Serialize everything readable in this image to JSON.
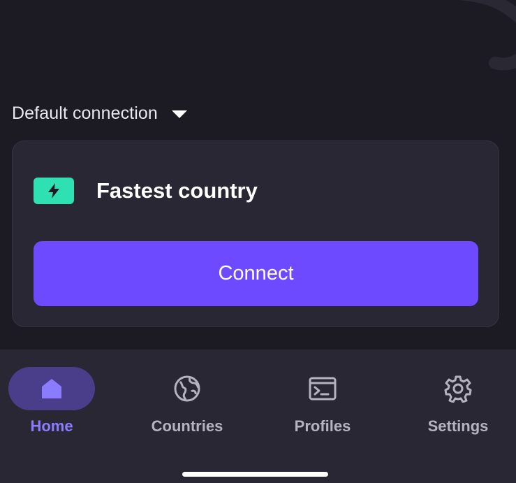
{
  "connection": {
    "selector_label": "Default connection"
  },
  "card": {
    "title": "Fastest country",
    "connect_label": "Connect",
    "badge_icon": "bolt-icon",
    "badge_color": "#2fe0b2"
  },
  "nav": {
    "items": [
      {
        "label": "Home",
        "icon": "home-icon",
        "active": true
      },
      {
        "label": "Countries",
        "icon": "globe-icon",
        "active": false
      },
      {
        "label": "Profiles",
        "icon": "terminal-icon",
        "active": false
      },
      {
        "label": "Settings",
        "icon": "gear-icon",
        "active": false
      }
    ]
  },
  "colors": {
    "background": "#1c1b24",
    "surface": "#292733",
    "accent": "#6d4aff",
    "active_nav": "#8b7bff"
  }
}
